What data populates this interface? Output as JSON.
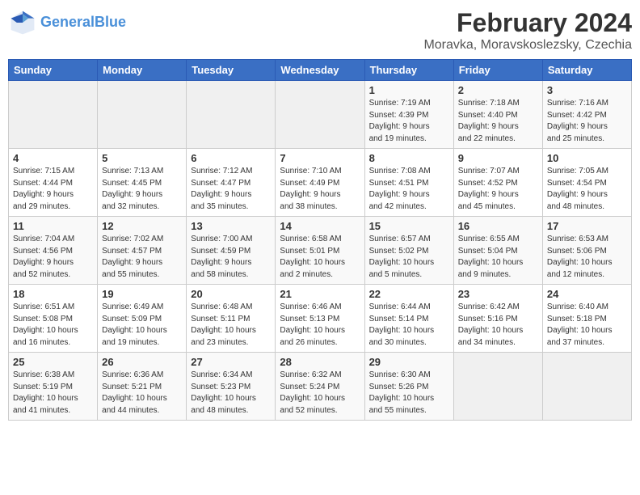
{
  "app": {
    "name": "GeneralBlue",
    "logo_text_part1": "General",
    "logo_text_part2": "Blue"
  },
  "calendar": {
    "title": "February 2024",
    "subtitle": "Moravka, Moravskoslezsky, Czechia",
    "headers": [
      "Sunday",
      "Monday",
      "Tuesday",
      "Wednesday",
      "Thursday",
      "Friday",
      "Saturday"
    ],
    "weeks": [
      [
        {
          "day": "",
          "info": ""
        },
        {
          "day": "",
          "info": ""
        },
        {
          "day": "",
          "info": ""
        },
        {
          "day": "",
          "info": ""
        },
        {
          "day": "1",
          "info": "Sunrise: 7:19 AM\nSunset: 4:39 PM\nDaylight: 9 hours\nand 19 minutes."
        },
        {
          "day": "2",
          "info": "Sunrise: 7:18 AM\nSunset: 4:40 PM\nDaylight: 9 hours\nand 22 minutes."
        },
        {
          "day": "3",
          "info": "Sunrise: 7:16 AM\nSunset: 4:42 PM\nDaylight: 9 hours\nand 25 minutes."
        }
      ],
      [
        {
          "day": "4",
          "info": "Sunrise: 7:15 AM\nSunset: 4:44 PM\nDaylight: 9 hours\nand 29 minutes."
        },
        {
          "day": "5",
          "info": "Sunrise: 7:13 AM\nSunset: 4:45 PM\nDaylight: 9 hours\nand 32 minutes."
        },
        {
          "day": "6",
          "info": "Sunrise: 7:12 AM\nSunset: 4:47 PM\nDaylight: 9 hours\nand 35 minutes."
        },
        {
          "day": "7",
          "info": "Sunrise: 7:10 AM\nSunset: 4:49 PM\nDaylight: 9 hours\nand 38 minutes."
        },
        {
          "day": "8",
          "info": "Sunrise: 7:08 AM\nSunset: 4:51 PM\nDaylight: 9 hours\nand 42 minutes."
        },
        {
          "day": "9",
          "info": "Sunrise: 7:07 AM\nSunset: 4:52 PM\nDaylight: 9 hours\nand 45 minutes."
        },
        {
          "day": "10",
          "info": "Sunrise: 7:05 AM\nSunset: 4:54 PM\nDaylight: 9 hours\nand 48 minutes."
        }
      ],
      [
        {
          "day": "11",
          "info": "Sunrise: 7:04 AM\nSunset: 4:56 PM\nDaylight: 9 hours\nand 52 minutes."
        },
        {
          "day": "12",
          "info": "Sunrise: 7:02 AM\nSunset: 4:57 PM\nDaylight: 9 hours\nand 55 minutes."
        },
        {
          "day": "13",
          "info": "Sunrise: 7:00 AM\nSunset: 4:59 PM\nDaylight: 9 hours\nand 58 minutes."
        },
        {
          "day": "14",
          "info": "Sunrise: 6:58 AM\nSunset: 5:01 PM\nDaylight: 10 hours\nand 2 minutes."
        },
        {
          "day": "15",
          "info": "Sunrise: 6:57 AM\nSunset: 5:02 PM\nDaylight: 10 hours\nand 5 minutes."
        },
        {
          "day": "16",
          "info": "Sunrise: 6:55 AM\nSunset: 5:04 PM\nDaylight: 10 hours\nand 9 minutes."
        },
        {
          "day": "17",
          "info": "Sunrise: 6:53 AM\nSunset: 5:06 PM\nDaylight: 10 hours\nand 12 minutes."
        }
      ],
      [
        {
          "day": "18",
          "info": "Sunrise: 6:51 AM\nSunset: 5:08 PM\nDaylight: 10 hours\nand 16 minutes."
        },
        {
          "day": "19",
          "info": "Sunrise: 6:49 AM\nSunset: 5:09 PM\nDaylight: 10 hours\nand 19 minutes."
        },
        {
          "day": "20",
          "info": "Sunrise: 6:48 AM\nSunset: 5:11 PM\nDaylight: 10 hours\nand 23 minutes."
        },
        {
          "day": "21",
          "info": "Sunrise: 6:46 AM\nSunset: 5:13 PM\nDaylight: 10 hours\nand 26 minutes."
        },
        {
          "day": "22",
          "info": "Sunrise: 6:44 AM\nSunset: 5:14 PM\nDaylight: 10 hours\nand 30 minutes."
        },
        {
          "day": "23",
          "info": "Sunrise: 6:42 AM\nSunset: 5:16 PM\nDaylight: 10 hours\nand 34 minutes."
        },
        {
          "day": "24",
          "info": "Sunrise: 6:40 AM\nSunset: 5:18 PM\nDaylight: 10 hours\nand 37 minutes."
        }
      ],
      [
        {
          "day": "25",
          "info": "Sunrise: 6:38 AM\nSunset: 5:19 PM\nDaylight: 10 hours\nand 41 minutes."
        },
        {
          "day": "26",
          "info": "Sunrise: 6:36 AM\nSunset: 5:21 PM\nDaylight: 10 hours\nand 44 minutes."
        },
        {
          "day": "27",
          "info": "Sunrise: 6:34 AM\nSunset: 5:23 PM\nDaylight: 10 hours\nand 48 minutes."
        },
        {
          "day": "28",
          "info": "Sunrise: 6:32 AM\nSunset: 5:24 PM\nDaylight: 10 hours\nand 52 minutes."
        },
        {
          "day": "29",
          "info": "Sunrise: 6:30 AM\nSunset: 5:26 PM\nDaylight: 10 hours\nand 55 minutes."
        },
        {
          "day": "",
          "info": ""
        },
        {
          "day": "",
          "info": ""
        }
      ]
    ]
  }
}
